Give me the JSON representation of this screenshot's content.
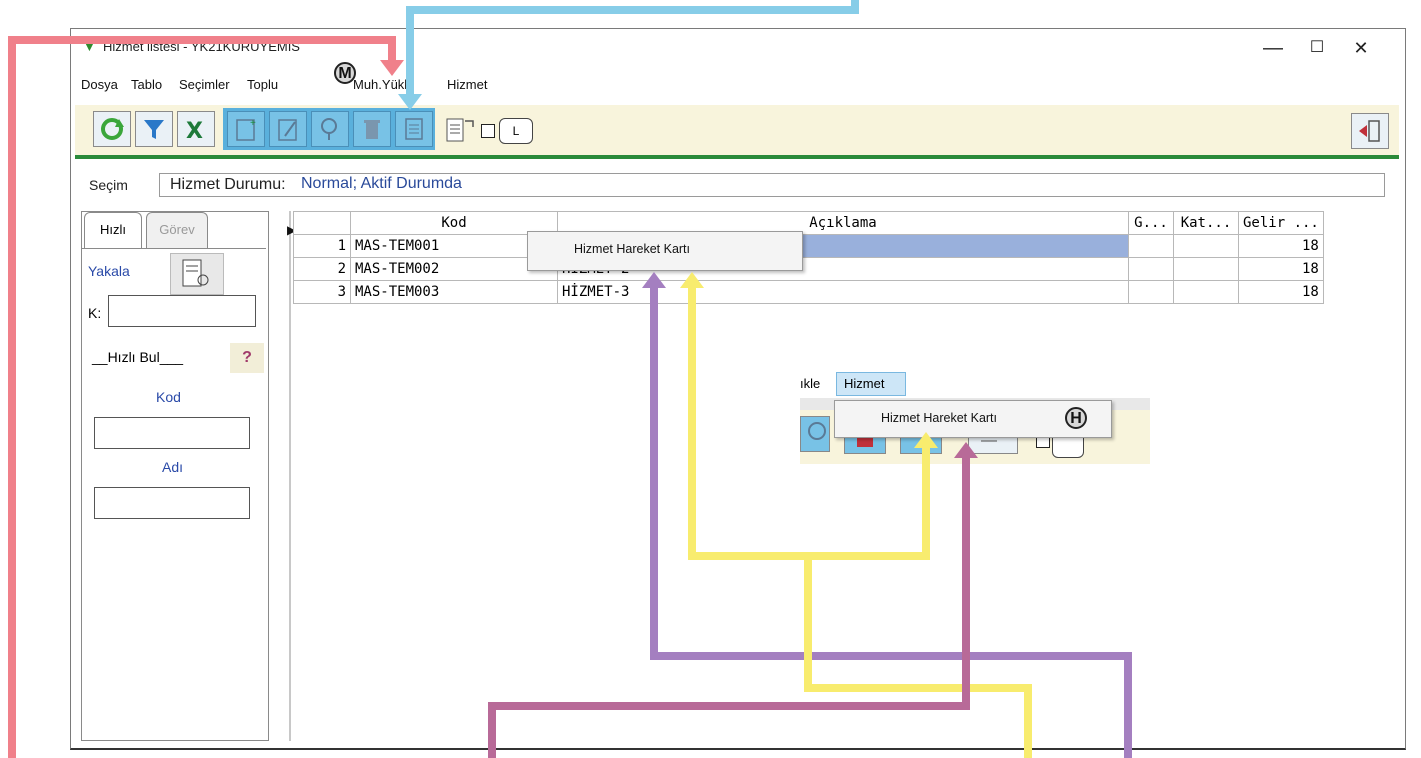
{
  "window": {
    "title": "Hizmet listesi - YK21KURUYEMIS",
    "minimize": "—",
    "maximize": "☐",
    "close": "✕"
  },
  "menu": [
    "Dosya",
    "Tablo",
    "Seçimler",
    "Toplu",
    "Muh.Yükle",
    "Hizmet"
  ],
  "toolbar": {
    "buttons": [
      "refresh-icon",
      "filter-icon",
      "excel-icon",
      "new-record-icon",
      "edit-icon",
      "search-icon",
      "delete-icon",
      "document-icon",
      "report-icon"
    ],
    "checkbox_label": "L",
    "exit": "exit-icon"
  },
  "selection": {
    "label": "Seçim",
    "prefix": "Hizmet Durumu:",
    "value": "Normal; Aktif Durumda"
  },
  "panel": {
    "tabs": [
      "Hızlı",
      "Görev"
    ],
    "yakala": "Yakala",
    "k_label": "K:",
    "hizli_bul": "__Hızlı Bul___",
    "help": "?",
    "kod_label": "Kod",
    "adi_label": "Adı"
  },
  "grid": {
    "columns": [
      "",
      "Kod",
      "Açıklama",
      "G...",
      "Kat...",
      "Gelir ..."
    ],
    "rows": [
      {
        "n": "1",
        "kod": "MAS-TEM001",
        "aciklama": "",
        "g": "",
        "kat": "",
        "gelir": "18"
      },
      {
        "n": "2",
        "kod": "MAS-TEM002",
        "aciklama": "HİZMET-2",
        "g": "",
        "kat": "",
        "gelir": "18"
      },
      {
        "n": "3",
        "kod": "MAS-TEM003",
        "aciklama": "HİZMET-3",
        "g": "",
        "kat": "",
        "gelir": "18"
      }
    ]
  },
  "context_menu": {
    "item": "Hizmet Hareket Kartı"
  },
  "inset": {
    "menu_fragment": "ıkle",
    "menu_hizmet": "Hizmet",
    "item": "Hizmet Hareket Kartı",
    "badge": "H"
  },
  "badges": {
    "m": "M"
  },
  "colors": {
    "red_arrow": "#f0808a",
    "blue_arrow": "#87cde8",
    "yellow_arrow": "#f8ec6e",
    "purple_arrow": "#a47fc0",
    "magenta_arrow": "#b86a98",
    "toolbar_bg": "#f8f4dc",
    "accent_green": "#2a8a3a",
    "selected_row": "#99b0dc"
  }
}
